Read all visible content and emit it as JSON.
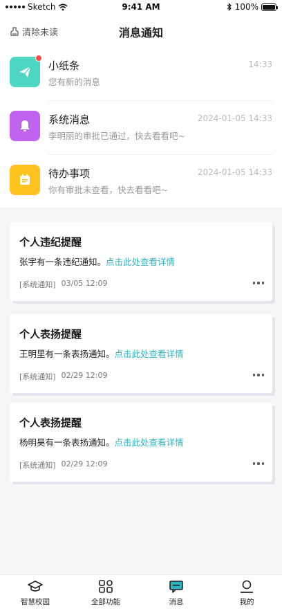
{
  "status": {
    "carrier": "Sketch",
    "time": "9:41 AM",
    "battery": "100%"
  },
  "header": {
    "clear_label": "清除未读",
    "title": "消息通知"
  },
  "messages": [
    {
      "title": "小纸条",
      "subtitle": "您有新的消息",
      "time": "14:33",
      "icon": "paper-plane-icon",
      "color": "#4dd6c2",
      "unread": true
    },
    {
      "title": "系统消息",
      "subtitle": "李明丽的审批已通过，快去看看吧~",
      "time": "2024-01-05 14:33",
      "icon": "bell-icon",
      "color": "#c064f0",
      "unread": false
    },
    {
      "title": "待办事项",
      "subtitle": "你有审批未查看，快去看看吧~",
      "time": "2024-01-05 14:33",
      "icon": "calendar-icon",
      "color": "#ffc21f",
      "unread": false
    }
  ],
  "cards": [
    {
      "title": "个人违纪提醒",
      "body": "张宇有一条违纪通知。",
      "link": "点击此处查看详情",
      "tag": "[系统通知]",
      "date": "03/05 12:09"
    },
    {
      "title": "个人表扬提醒",
      "body": "王明里有一条表扬通知。",
      "link": "点击此处查看详情",
      "tag": "[系统通知]",
      "date": "02/29 12:09"
    },
    {
      "title": "个人表扬提醒",
      "body": "杨明昊有一条表扬通知。",
      "link": "点击此处查看详情",
      "tag": "[系统通知]",
      "date": "02/29 12:09"
    }
  ],
  "tabs": [
    {
      "label": "智慧校园",
      "icon": "graduation-cap-icon"
    },
    {
      "label": "全部功能",
      "icon": "grid-icon"
    },
    {
      "label": "消息",
      "icon": "chat-icon",
      "active": true
    },
    {
      "label": "我的",
      "icon": "user-icon"
    }
  ]
}
